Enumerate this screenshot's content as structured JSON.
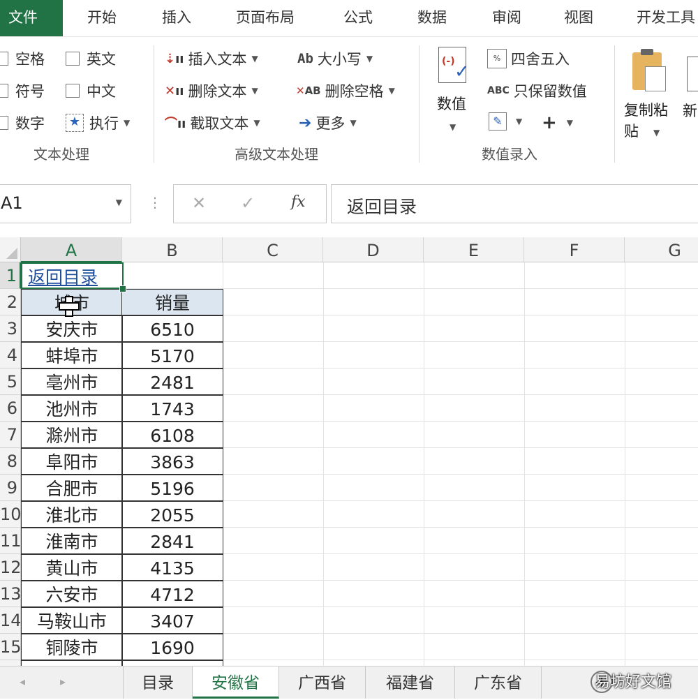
{
  "menu": {
    "tabs": [
      "文件",
      "开始",
      "插入",
      "页面布局",
      "公式",
      "数据",
      "审阅",
      "视图",
      "开发工具"
    ]
  },
  "ribbon": {
    "text_processing": {
      "items": [
        "空格",
        "英文",
        "符号",
        "中文",
        "数字",
        "执行"
      ],
      "group_label": "文本处理"
    },
    "advanced_text": {
      "insert_text": "插入文本",
      "delete_text": "删除文本",
      "extract_text": "截取文本",
      "case": "大小写",
      "delete_space": "删除空格",
      "more": "更多",
      "case_icon": "Ab",
      "delete_space_icon": "AB",
      "group_label": "高级文本处理"
    },
    "number_entry": {
      "value_button": "数值",
      "round": "四舍五入",
      "keep_numbers": "只保留数值",
      "keep_icon": "ABC",
      "plus": "+",
      "group_label": "数值录入"
    },
    "copy_paste": "复制粘贴",
    "new_partial": "新"
  },
  "formula_bar": {
    "name_box": "A1",
    "cancel": "✕",
    "confirm": "✓",
    "fx": "fx",
    "content": "返回目录"
  },
  "sheet": {
    "columns": [
      "A",
      "B",
      "C",
      "D",
      "E",
      "F",
      "G"
    ],
    "row_numbers": [
      "1",
      "2",
      "3",
      "4",
      "5",
      "6",
      "7",
      "8",
      "9",
      "10",
      "11",
      "12",
      "13",
      "14",
      "15"
    ],
    "a1": "返回目录",
    "header_city": "城市",
    "header_sales": "销量",
    "rows": [
      {
        "city": "安庆市",
        "sales": "6510"
      },
      {
        "city": "蚌埠市",
        "sales": "5170"
      },
      {
        "city": "亳州市",
        "sales": "2481"
      },
      {
        "city": "池州市",
        "sales": "1743"
      },
      {
        "city": "滁州市",
        "sales": "6108"
      },
      {
        "city": "阜阳市",
        "sales": "3863"
      },
      {
        "city": "合肥市",
        "sales": "5196"
      },
      {
        "city": "淮北市",
        "sales": "2055"
      },
      {
        "city": "淮南市",
        "sales": "2841"
      },
      {
        "city": "黄山市",
        "sales": "4135"
      },
      {
        "city": "六安市",
        "sales": "4712"
      },
      {
        "city": "马鞍山市",
        "sales": "3407"
      },
      {
        "city": "铜陵市",
        "sales": "1690"
      }
    ]
  },
  "sheet_tabs": {
    "tabs": [
      "目录",
      "安徽省",
      "广西省",
      "福建省",
      "广东省"
    ],
    "active": "安徽省"
  },
  "watermark": "易坊好文馆",
  "colors": {
    "accent": "#217346",
    "link": "#1f4e9e",
    "header_fill": "#dce6f1"
  }
}
